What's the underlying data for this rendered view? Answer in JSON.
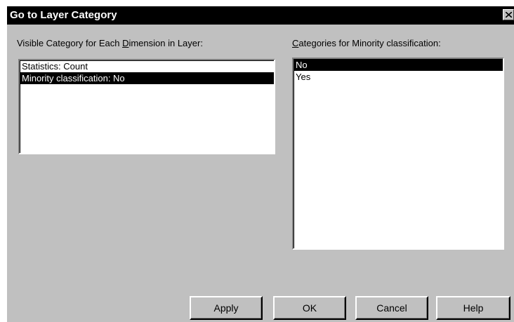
{
  "dialog": {
    "title": "Go to Layer Category",
    "close_label": "Close"
  },
  "left_panel": {
    "label_before": "Visible Category for Each ",
    "label_accel": "D",
    "label_after": "imension in Layer:",
    "items": [
      {
        "label": "Statistics: Count",
        "selected": false
      },
      {
        "label": "Minority classification: No",
        "selected": true
      }
    ]
  },
  "right_panel": {
    "label_accel": "C",
    "label_after": "ategories for Minority classification:",
    "items": [
      {
        "label": "No",
        "selected": true
      },
      {
        "label": "Yes",
        "selected": false
      }
    ]
  },
  "buttons": {
    "apply": "Apply",
    "ok": "OK",
    "cancel": "Cancel",
    "help": "Help"
  },
  "colors": {
    "dialog_bg": "#c0c0c0",
    "titlebar_bg": "#000000",
    "selection_bg": "#000000",
    "list_bg": "#ffffff"
  }
}
